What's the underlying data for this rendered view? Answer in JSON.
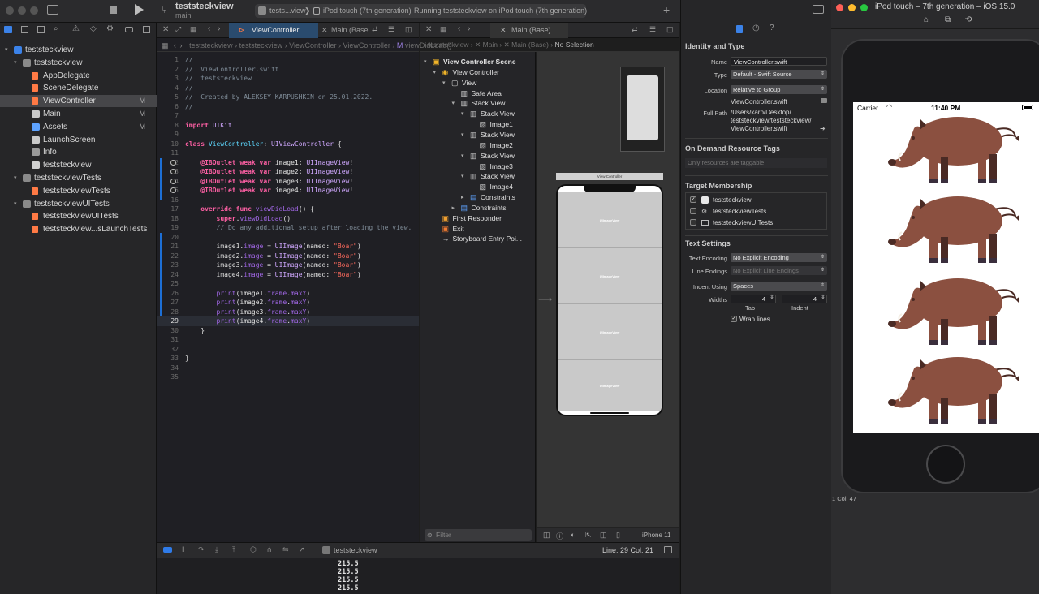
{
  "toolbar": {
    "project_title": "teststeckview",
    "branch": "main",
    "scheme": "tests...view",
    "device": "iPod touch (7th generation)",
    "status": "Running teststeckview on iPod touch (7th generation)"
  },
  "navigator": {
    "items": [
      {
        "label": "teststeckview",
        "level": 0,
        "icon": "project-icon",
        "expanded": true
      },
      {
        "label": "teststeckview",
        "level": 1,
        "icon": "folder-icon",
        "expanded": true
      },
      {
        "label": "AppDelegate",
        "level": 2,
        "icon": "swift-file-icon"
      },
      {
        "label": "SceneDelegate",
        "level": 2,
        "icon": "swift-file-icon"
      },
      {
        "label": "ViewController",
        "level": 2,
        "icon": "swift-file-icon",
        "badge": "M",
        "selected": true
      },
      {
        "label": "Main",
        "level": 2,
        "icon": "storyboard-icon",
        "badge": "M"
      },
      {
        "label": "Assets",
        "level": 2,
        "icon": "assets-icon",
        "badge": "M"
      },
      {
        "label": "LaunchScreen",
        "level": 2,
        "icon": "storyboard-icon"
      },
      {
        "label": "Info",
        "level": 2,
        "icon": "plist-icon"
      },
      {
        "label": "teststeckview",
        "level": 2,
        "icon": "test-file-icon"
      },
      {
        "label": "teststeckviewTests",
        "level": 1,
        "icon": "folder-icon",
        "expanded": true
      },
      {
        "label": "teststeckviewTests",
        "level": 2,
        "icon": "swift-file-icon"
      },
      {
        "label": "teststeckviewUITests",
        "level": 1,
        "icon": "folder-icon",
        "expanded": true
      },
      {
        "label": "teststeckviewUITests",
        "level": 2,
        "icon": "swift-file-icon"
      },
      {
        "label": "teststeckview...sLaunchTests",
        "level": 2,
        "icon": "swift-file-icon"
      }
    ]
  },
  "editor": {
    "tab_active": "ViewController",
    "tab_second": "Main (Base",
    "breadcrumb": [
      "teststeckview",
      "teststeckview",
      "ViewController",
      "ViewController",
      "viewDidLoad()"
    ],
    "current_line": 29,
    "lines": [
      "//",
      "//  ViewController.swift",
      "//  teststeckview",
      "//",
      "//  Created by ALEKSEY KARPUSHKIN on 25.01.2022.",
      "//",
      "",
      "import UIKit",
      "",
      "class ViewController: UIViewController {",
      "",
      "    @IBOutlet weak var image1: UIImageView!",
      "    @IBOutlet weak var image2: UIImageView!",
      "    @IBOutlet weak var image3: UIImageView!",
      "    @IBOutlet weak var image4: UIImageView!",
      "",
      "    override func viewDidLoad() {",
      "        super.viewDidLoad()",
      "        // Do any additional setup after loading the view.",
      "",
      "        image1.image = UIImage(named: \"Boar\")",
      "        image2.image = UIImage(named: \"Boar\")",
      "        image3.image = UIImage(named: \"Boar\")",
      "        image4.image = UIImage(named: \"Boar\")",
      "",
      "        print(image1.frame.maxY)",
      "        print(image2.frame.maxY)",
      "        print(image3.frame.maxY)",
      "        print(image4.frame.maxY)",
      "    }",
      "",
      "",
      "}",
      "",
      ""
    ]
  },
  "debug": {
    "target": "teststeckview",
    "line_col": "Line: 29  Col: 21",
    "console": [
      "215.5",
      "215.5",
      "215.5",
      "215.5"
    ]
  },
  "ib": {
    "tab": "Main (Base)",
    "breadcrumb": [
      "teststeckview",
      "Main",
      "Main (Base)",
      "No Selection"
    ],
    "outline": [
      {
        "label": "View Controller Scene",
        "level": 0,
        "bold": true,
        "tri": "open",
        "icon": "scene-icon"
      },
      {
        "label": "View Controller",
        "level": 1,
        "tri": "open",
        "icon": "viewcontroller-icon"
      },
      {
        "label": "View",
        "level": 2,
        "tri": "open",
        "icon": "view-icon"
      },
      {
        "label": "Safe Area",
        "level": 3,
        "tri": "",
        "icon": "safearea-icon"
      },
      {
        "label": "Stack View",
        "level": 3,
        "tri": "open",
        "icon": "stackview-icon"
      },
      {
        "label": "Stack View",
        "level": 4,
        "tri": "open",
        "icon": "stackview-icon"
      },
      {
        "label": "Image1",
        "level": 5,
        "tri": "",
        "icon": "imageview-icon"
      },
      {
        "label": "Stack View",
        "level": 4,
        "tri": "open",
        "icon": "stackview-icon"
      },
      {
        "label": "Image2",
        "level": 5,
        "tri": "",
        "icon": "imageview-icon"
      },
      {
        "label": "Stack View",
        "level": 4,
        "tri": "open",
        "icon": "stackview-icon"
      },
      {
        "label": "Image3",
        "level": 5,
        "tri": "",
        "icon": "imageview-icon"
      },
      {
        "label": "Stack View",
        "level": 4,
        "tri": "open",
        "icon": "stackview-icon"
      },
      {
        "label": "Image4",
        "level": 5,
        "tri": "",
        "icon": "imageview-icon"
      },
      {
        "label": "Constraints",
        "level": 4,
        "tri": "closed",
        "icon": "constraints-icon"
      },
      {
        "label": "Constraints",
        "level": 3,
        "tri": "closed",
        "icon": "constraints-icon"
      },
      {
        "label": "First Responder",
        "level": 1,
        "tri": "",
        "icon": "firstresponder-icon"
      },
      {
        "label": "Exit",
        "level": 1,
        "tri": "",
        "icon": "exit-icon"
      },
      {
        "label": "Storyboard Entry Poi...",
        "level": 1,
        "tri": "",
        "icon": "entry-arrow-icon"
      }
    ],
    "filter_placeholder": "Filter",
    "canvas_vc_title": "View Controller",
    "imageview_label": "UIImageView",
    "device_label": "iPhone 11"
  },
  "inspector": {
    "identity_title": "Identity and Type",
    "name_label": "Name",
    "name_value": "ViewController.swift",
    "type_label": "Type",
    "type_value": "Default - Swift Source",
    "location_label": "Location",
    "location_value": "Relative to Group",
    "location_file": "ViewController.swift",
    "fullpath_label": "Full Path",
    "fullpath_lines": [
      "/Users/karp/Desktop/",
      "teststeckview/teststeckview/",
      "ViewController.swift"
    ],
    "odr_title": "On Demand Resource Tags",
    "odr_placeholder": "Only resources are taggable",
    "tm_title": "Target Membership",
    "targets": [
      {
        "label": "teststeckview",
        "checked": true
      },
      {
        "label": "teststeckviewTests",
        "checked": false
      },
      {
        "label": "teststeckviewUITests",
        "checked": false
      }
    ],
    "text_settings_title": "Text Settings",
    "encoding_label": "Text Encoding",
    "encoding_value": "No Explicit Encoding",
    "endings_label": "Line Endings",
    "endings_value": "No Explicit Line Endings",
    "indent_label": "Indent Using",
    "indent_value": "Spaces",
    "widths_label": "Widths",
    "tab_value": "4",
    "indent_num": "4",
    "tab_caption": "Tab",
    "indent_caption": "Indent",
    "wrap_label": "Wrap lines"
  },
  "simulator": {
    "title": "iPod touch – 7th generation – iOS 15.0",
    "carrier": "Carrier",
    "time": "11:40 PM",
    "behind_fragment": "1  Col: 47"
  },
  "colors": {
    "accent": "#1d6fd6",
    "boar_body": "#8b5040",
    "boar_dark": "#4a2a24",
    "tab_active": "#2a4b6e"
  }
}
